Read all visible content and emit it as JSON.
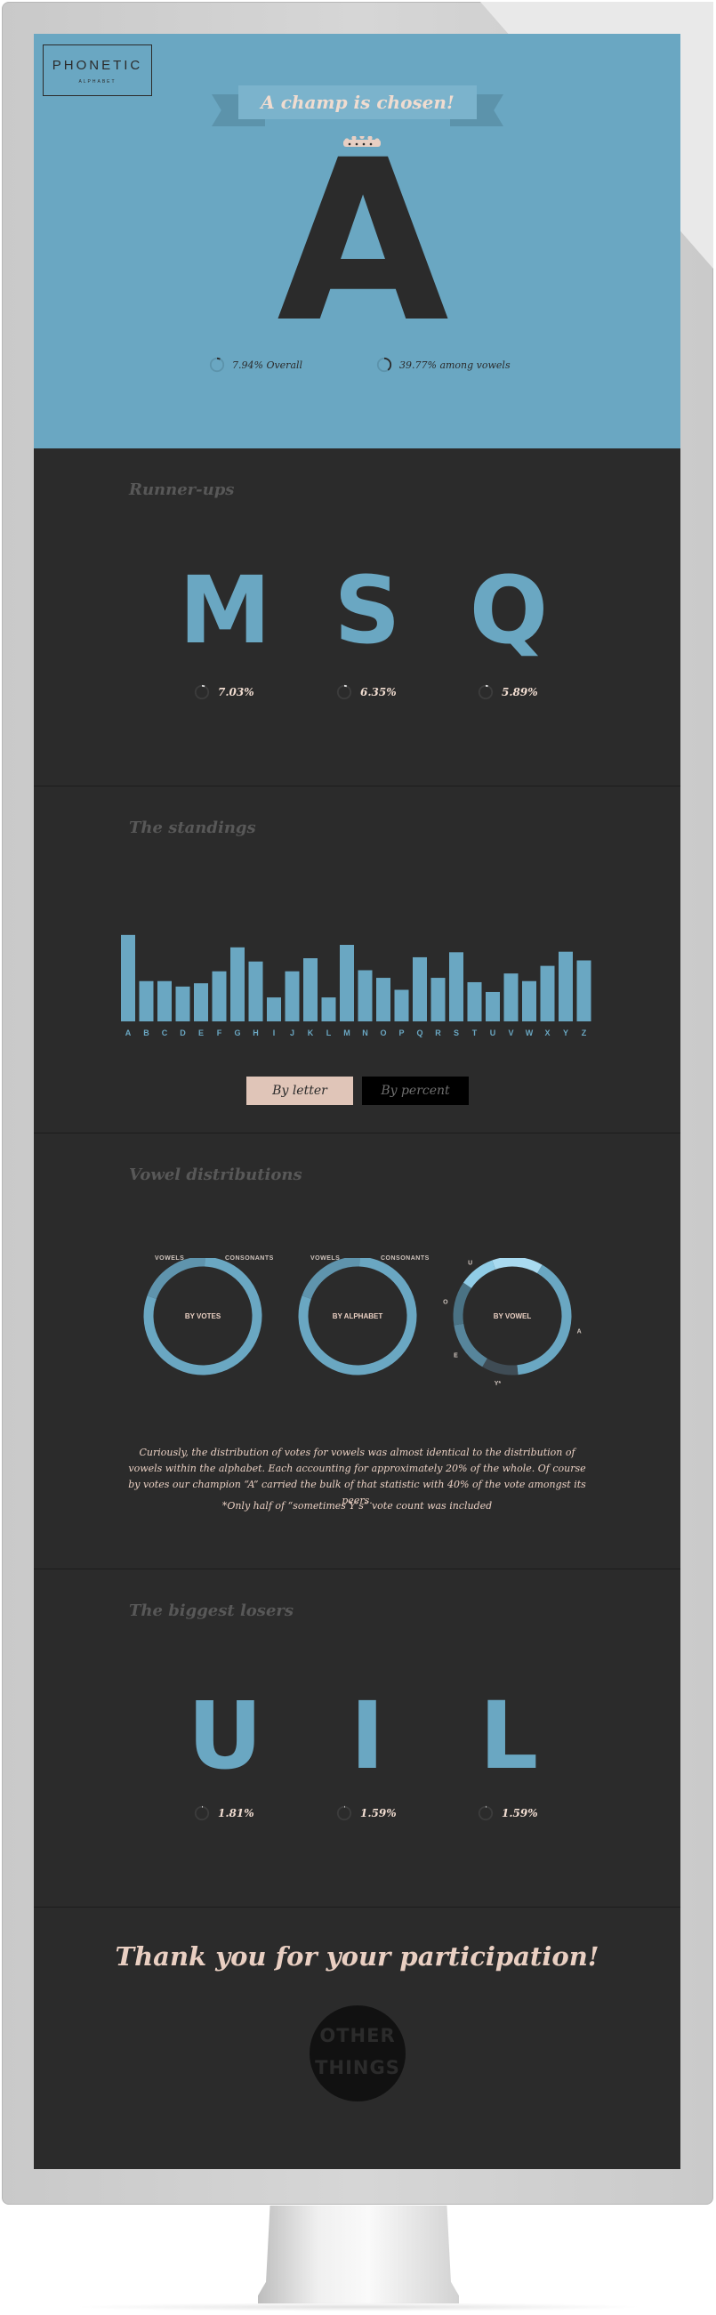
{
  "logo": {
    "name": "PHONETIC",
    "sub": "ALPHABET"
  },
  "hero": {
    "banner": "A champ is chosen!",
    "champion": "A",
    "stats": [
      {
        "label": "7.94% Overall",
        "value": 7.94
      },
      {
        "label": "39.77% among vowels",
        "value": 39.77
      }
    ]
  },
  "runner_ups": {
    "title": "Runner-ups",
    "letters": [
      {
        "letter": "M",
        "pct": "7.03%",
        "value": 7.03
      },
      {
        "letter": "S",
        "pct": "6.35%",
        "value": 6.35
      },
      {
        "letter": "Q",
        "pct": "5.89%",
        "value": 5.89
      }
    ]
  },
  "standings": {
    "title": "The standings",
    "toggle_on": "By letter",
    "toggle_off": "By percent"
  },
  "chart_data": {
    "type": "bar",
    "categories": [
      "A",
      "B",
      "C",
      "D",
      "E",
      "F",
      "G",
      "H",
      "I",
      "J",
      "K",
      "L",
      "M",
      "N",
      "O",
      "P",
      "Q",
      "R",
      "S",
      "T",
      "U",
      "V",
      "W",
      "X",
      "Y",
      "Z"
    ],
    "values": [
      7.94,
      3.7,
      3.7,
      3.2,
      3.5,
      4.6,
      6.8,
      5.5,
      2.2,
      4.6,
      5.8,
      2.2,
      7.03,
      4.7,
      4.0,
      2.9,
      5.89,
      4.0,
      6.35,
      3.6,
      2.7,
      4.4,
      3.7,
      5.1,
      6.4,
      5.6
    ],
    "title": "",
    "xlabel": "",
    "ylabel": "",
    "ylim": [
      0,
      8.5
    ]
  },
  "vowels": {
    "title": "Vowel distributions",
    "donuts": [
      {
        "caption": "BY VOTES",
        "left_label": "VOWELS",
        "right_label": "CONSONANTS",
        "segments": [
          20,
          80
        ]
      },
      {
        "caption": "BY ALPHABET",
        "left_label": "VOWELS",
        "right_label": "CONSONANTS",
        "segments": [
          20,
          80
        ]
      },
      {
        "caption": "BY VOWEL",
        "labels": [
          "I",
          "A",
          "Y*",
          "E",
          "O",
          "U"
        ],
        "segments": [
          14,
          40,
          10,
          14,
          12,
          10
        ]
      }
    ],
    "paragraph": "Curiously, the distribution of votes for vowels was almost identical to the distribution of vowels within the alphabet. Each accounting for approximately 20% of the whole. Of course by votes our champion “A” carried the bulk of that statistic with 40% of the vote amongst its peers.",
    "footnote": "*Only half of “sometimes Y’s” vote count was included"
  },
  "losers": {
    "title": "The biggest losers",
    "letters": [
      {
        "letter": "U",
        "pct": "1.81%",
        "value": 1.81
      },
      {
        "letter": "I",
        "pct": "1.59%",
        "value": 1.59
      },
      {
        "letter": "L",
        "pct": "1.59%",
        "value": 1.59
      }
    ]
  },
  "footer": {
    "thanks": "Thank you for your participation!",
    "badge_lines": [
      "OTHER",
      "THINGS"
    ]
  },
  "colors": {
    "blue": "#6aa7c2",
    "dark": "#2b2b2b",
    "peach": "#e9cfc2"
  }
}
